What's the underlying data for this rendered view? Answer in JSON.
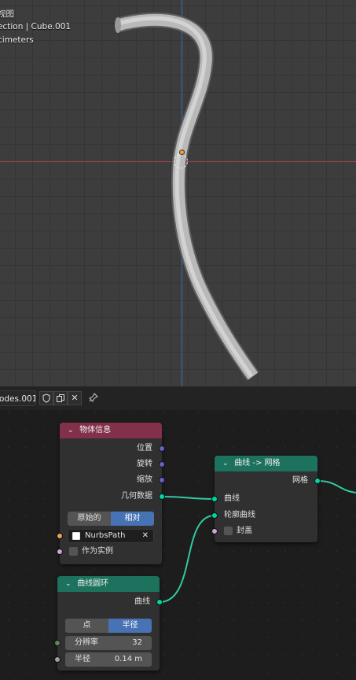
{
  "viewport": {
    "view_label": "视图",
    "collection_label": "ection | Cube.001",
    "units_label": "cimeters"
  },
  "editor": {
    "tree_name": "odes.001",
    "buttons": [
      "shield-icon",
      "copy-icon",
      "close-icon",
      "pin-icon"
    ]
  },
  "nodes": {
    "object_info": {
      "title": "物体信息",
      "outputs": [
        "位置",
        "旋转",
        "缩放",
        "几何数据"
      ],
      "mode_options": [
        "原始的",
        "相对"
      ],
      "mode_selected": "相对",
      "object": "NurbsPath",
      "as_instance_label": "作为实例"
    },
    "curve_to_mesh": {
      "title": "曲线 -> 网格",
      "output": "网格",
      "inputs": [
        "曲线",
        "轮廓曲线"
      ],
      "fill_caps_label": "封盖"
    },
    "curve_circle": {
      "title": "曲线圆环",
      "output": "曲线",
      "mode_options": [
        "点",
        "半径"
      ],
      "mode_selected": "半径",
      "resolution_label": "分辨率",
      "resolution_value": "32",
      "radius_label": "半径",
      "radius_value": "0.14 m"
    }
  },
  "colors": {
    "object_info_header": "#83314a",
    "geometry_header": "#1d725e",
    "geometry_socket": "#00d6a3",
    "vector_socket": "#6363c7",
    "object_socket": "#ed9e5c",
    "bool_socket": "#cca6d6",
    "int_socket": "#598c5c",
    "float_socket": "#a1a1a1"
  }
}
